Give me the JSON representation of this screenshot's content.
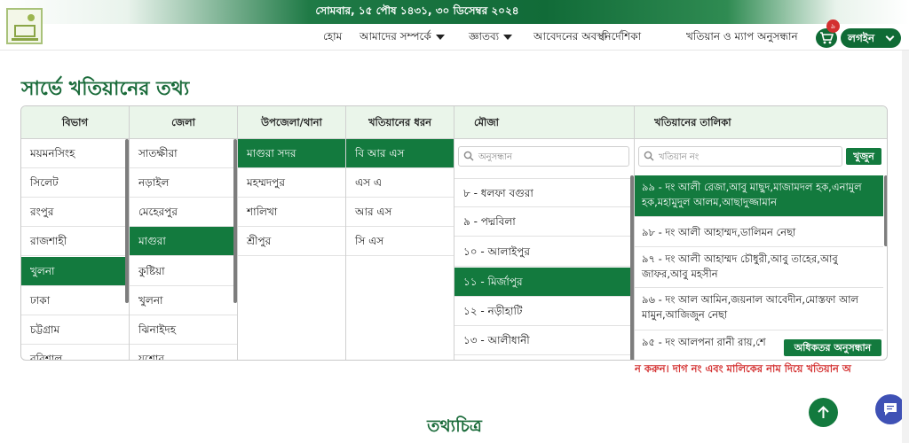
{
  "topbar": {
    "date": "সোমবার, ১৫ পৌষ ১৪৩১, ৩০ ডিসেম্বর ২০২৪"
  },
  "nav": {
    "items": [
      {
        "label": "হোম"
      },
      {
        "label": "আমাদের সম্পর্কে",
        "dropdown": true
      },
      {
        "label": "জ্ঞাতব্য",
        "dropdown": true
      },
      {
        "label": "আবেদনের অবস্থা"
      },
      {
        "label": "নির্দেশিকা"
      },
      {
        "label": "খতিয়ান ও ম্যাপ অনুসন্ধান"
      }
    ],
    "cart_count": "৯",
    "login_label": "লগইন"
  },
  "page": {
    "title": "সার্ভে খতিয়ানের তথ্য",
    "infograph_title": "তথ্যচিত্র"
  },
  "columns": {
    "division": {
      "header": "বিভাগ",
      "items": [
        "ময়মনসিংহ",
        "সিলেট",
        "রংপুর",
        "রাজশাহী",
        "খুলনা",
        "ঢাকা",
        "চট্টগ্রাম",
        "বরিশাল"
      ],
      "selected": "খুলনা"
    },
    "district": {
      "header": "জেলা",
      "items": [
        "সাতক্ষীরা",
        "নড়াইল",
        "মেহেরপুর",
        "মাগুরা",
        "কুষ্টিয়া",
        "খুলনা",
        "ঝিনাইদহ",
        "যশোর"
      ],
      "selected": "মাগুরা"
    },
    "upazila": {
      "header": "উপজেলা/থানা",
      "items": [
        "মাগুরা সদর",
        "মহম্মদপুর",
        "শালিখা",
        "শ্রীপুর"
      ],
      "selected": "মাগুরা সদর"
    },
    "khatian_type": {
      "header": "খতিয়ানের ধরন",
      "items": [
        "বি আর এস",
        "এস এ",
        "আর এস",
        "সি এস"
      ],
      "selected": "বি আর এস"
    },
    "mouza": {
      "header": "মৌজা",
      "search_placeholder": "অনুসন্ধান",
      "items": [
        "৮ - ধলফা বগুরা",
        "৯ - পদ্মবিলা",
        "১০ - আলাইপুর",
        "১১ - মির্জাপুর",
        "১২ - নড়ীহাটি",
        "১৩ - আলীধানী"
      ],
      "selected": "১১ - মির্জাপুর"
    },
    "khatian_list": {
      "header": "খতিয়ানের তালিকা",
      "search_placeholder": "খতিয়ান নং",
      "search_button": "খুজুন",
      "items": [
        "৯৯ - দং আলী রেজা,আবু মাছুদ,মাজামদল হক,এনামুল হক,মহামুদুল আলম,আছাদুজ্জামান",
        "৯৮ - দং আলী আহাম্মদ,ডালিমন নেছা",
        "৯৭ - দং আলী আহাম্মদ চৌধুরী,আবু তাহের,আবু জাফর,আবু মহসীন",
        "৯৬ - দং আল আমিন,জয়নাল আবেদীন,মোস্তফা আল মামুন,আজিজুন নেছা",
        "৯৫ - দং আলপনা রানী রায়,শে"
      ],
      "selected_index": 0,
      "more_button": "অধিকতর অনুসন্ধান"
    }
  },
  "notice": {
    "text": "ন করুন। দাগ নং এবং মালিকের নাম দিয়ে খতিয়ান অ"
  },
  "colors": {
    "primary_green": "#137a3e",
    "header_bg": "#eaf5ea",
    "notice_red": "#d32f2f",
    "chat_blue": "#3f51b5"
  }
}
